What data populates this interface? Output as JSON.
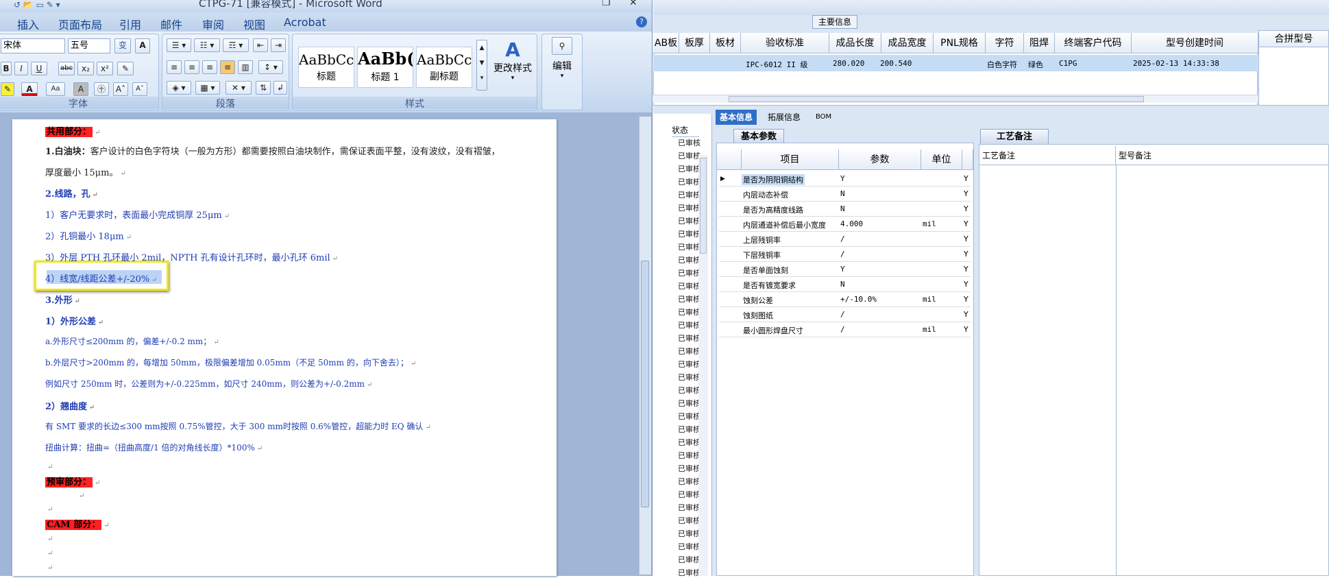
{
  "word": {
    "title": "CTPG-71 [兼容模式] - Microsoft Word",
    "tabs": [
      "插入",
      "页面布局",
      "引用",
      "邮件",
      "审阅",
      "视图",
      "Acrobat"
    ],
    "font_name": "宋体",
    "font_size": "五号",
    "groups": {
      "font": "字体",
      "paragraph": "段落",
      "styles": "样式"
    },
    "styles": [
      {
        "preview": "AaBbCc",
        "name": "标题"
      },
      {
        "preview": "AaBb(",
        "name": "标题 1"
      },
      {
        "preview": "AaBbCc",
        "name": "副标题"
      }
    ],
    "change_styles": "更改样式",
    "edit": "编辑",
    "doc": {
      "l1": "共用部分：",
      "l2a": "1.白油块：",
      "l2b": "客户设计的白色字符块（一般为方形）都需要按照白油块制作，需保证表面平整，没有波纹，没有褶皱，",
      "l3": "厚度最小 15μm。",
      "l4": "2.线路，孔",
      "l5": "1）客户无要求时，表面最小完成铜厚 25μm",
      "l6": "2）孔铜最小 18μm",
      "l7": "3）外层 PTH 孔环最小 2mil，NPTH 孔有设计孔环时，最小孔环 6mil",
      "l8": "4）线宽/线距公差+/-20%",
      "l9": "3.外形",
      "l10": "1）外形公差",
      "l11": "a.外形尺寸≤200mm 的，偏差+/-0.2 mm；",
      "l12": "b.外层尺寸>200mm 的，每增加 50mm，极限偏差增加 0.05mm（不足 50mm 的，向下舍去）；",
      "l13": "例如尺寸 250mm 时，公差则为+/-0.225mm，如尺寸 240mm，则公差为+/-0.2mm",
      "l14": "2）翘曲度",
      "l15": "有 SMT 要求的长边≤300 mm按照 0.75%管控，大于 300 mm时按照 0.6%管控，超能力时 EQ 确认",
      "l16": "扭曲计算：扭曲=（扭曲高度/1 倍的对角线长度）*100%",
      "l17": "预审部分：",
      "l18": "CAM 部分："
    }
  },
  "app": {
    "main_info_label": "主要信息",
    "headers": [
      "AB板",
      "板厚",
      "板材",
      "验收标准",
      "成品长度",
      "成品宽度",
      "PNL规格",
      "字符",
      "阻焊",
      "终端客户代码",
      "型号创建时间"
    ],
    "merge_header": "合拼型号",
    "row": {
      "standard": "IPC-6012 II 级",
      "length": "280.020",
      "width": "200.540",
      "char": "白色字符",
      "mask": "绿色",
      "client": "C1PG",
      "created": "2025-02-13 14:33:38"
    },
    "status_header": "状态",
    "status_value": "已审核",
    "tabs": [
      "基本信息",
      "拓展信息",
      "BOM"
    ],
    "subtab": "基本参数",
    "process_tab": "工艺备注",
    "grid_headers": [
      "项目",
      "参数",
      "单位"
    ],
    "notes_headers": [
      "工艺备注",
      "型号备注"
    ],
    "params": [
      {
        "name": "是否为阴阳铜结构",
        "value": "Y",
        "unit": "",
        "flag": "Y"
      },
      {
        "name": "内层动态补偿",
        "value": "N",
        "unit": "",
        "flag": "Y"
      },
      {
        "name": "是否为高精度线路",
        "value": "N",
        "unit": "",
        "flag": "Y"
      },
      {
        "name": "内层通道补偿后最小宽度",
        "value": "4.000",
        "unit": "mil",
        "flag": "Y"
      },
      {
        "name": "上层残铜率",
        "value": "/",
        "unit": "",
        "flag": "Y"
      },
      {
        "name": "下层残铜率",
        "value": "/",
        "unit": "",
        "flag": "Y"
      },
      {
        "name": "是否单面蚀刻",
        "value": "Y",
        "unit": "",
        "flag": "Y"
      },
      {
        "name": "是否有镀宽要求",
        "value": "N",
        "unit": "",
        "flag": "Y"
      },
      {
        "name": "蚀刻公差",
        "value": "+/-10.0%",
        "unit": "mil",
        "flag": "Y"
      },
      {
        "name": "蚀刻图纸",
        "value": "/",
        "unit": "",
        "flag": "Y"
      },
      {
        "name": "最小圆形焊盘尺寸",
        "value": "/",
        "unit": "mil",
        "flag": "Y"
      }
    ]
  }
}
